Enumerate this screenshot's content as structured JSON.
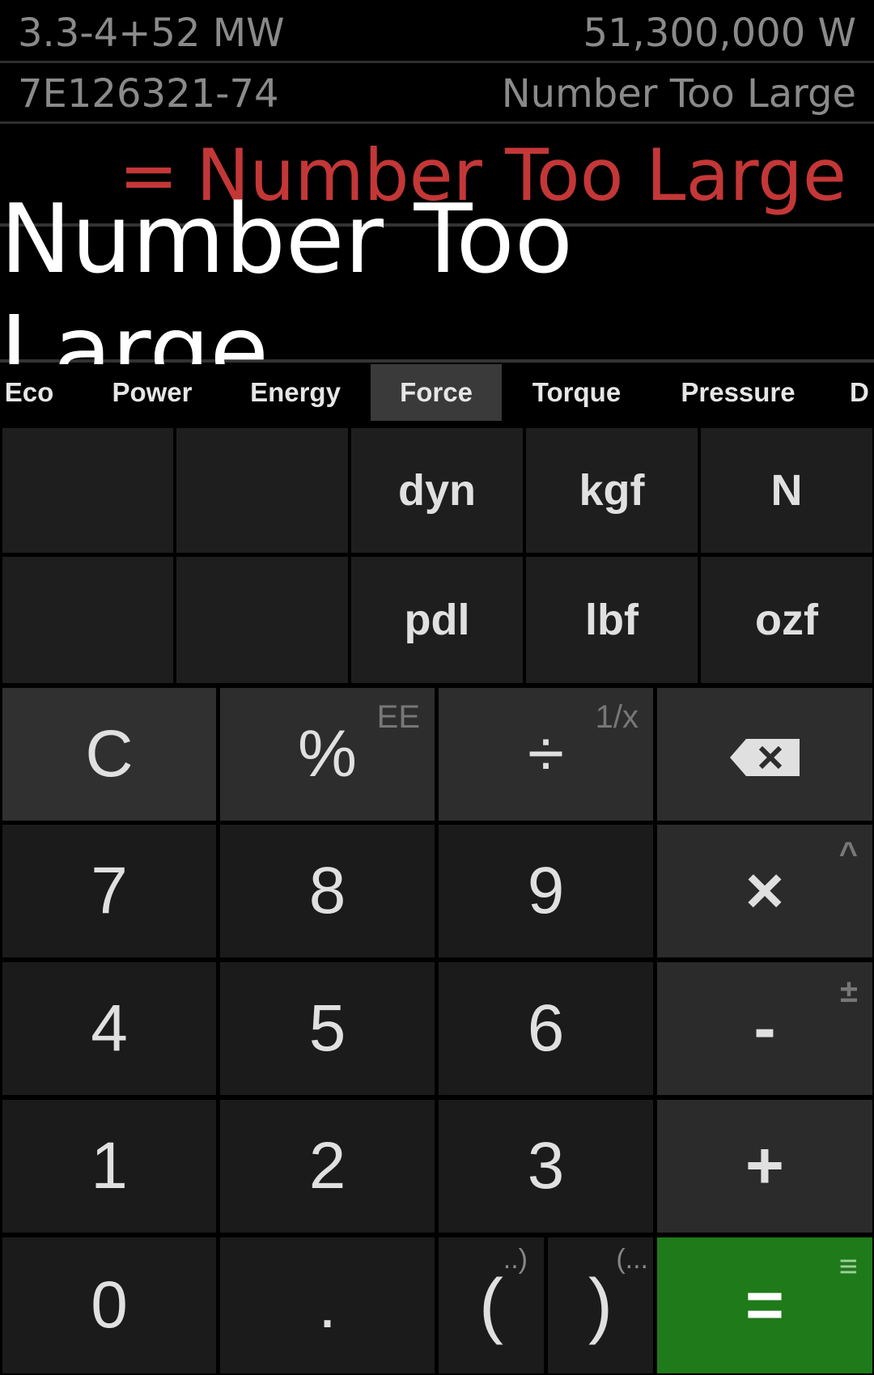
{
  "history": [
    {
      "expression": "3.3-4+52 MW",
      "result": "51,300,000 W"
    },
    {
      "expression": "7E126321-74",
      "result": "Number Too Large"
    }
  ],
  "result_line": {
    "equals": "=",
    "text": "Number Too Large"
  },
  "main_display": "Number Too Large",
  "tabs": [
    "Eco",
    "Power",
    "Energy",
    "Force",
    "Torque",
    "Pressure",
    "D"
  ],
  "active_tab": "Force",
  "units": {
    "row1": [
      "",
      "",
      "dyn",
      "kgf",
      "N"
    ],
    "row2": [
      "",
      "",
      "pdl",
      "lbf",
      "ozf"
    ]
  },
  "keys": {
    "clear": "C",
    "percent": "%",
    "percent_alt": "EE",
    "divide": "÷",
    "divide_alt": "1/x",
    "backspace": "backspace-icon",
    "seven": "7",
    "eight": "8",
    "nine": "9",
    "multiply": "×",
    "multiply_alt": "^",
    "four": "4",
    "five": "5",
    "six": "6",
    "minus": "-",
    "minus_alt": "±",
    "one": "1",
    "two": "2",
    "three": "3",
    "plus": "+",
    "zero": "0",
    "dot": ".",
    "open_paren": "(",
    "open_paren_alt": "..)",
    "close_paren": ")",
    "close_paren_alt": "(...",
    "equals": "=",
    "equals_alt": "≡"
  },
  "colors": {
    "result_red": "#c43737",
    "equals_green": "#1f7a1a",
    "background": "#000000"
  }
}
